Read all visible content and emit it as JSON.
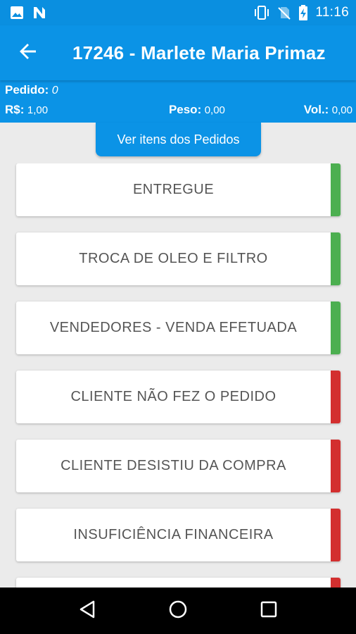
{
  "status_bar": {
    "time": "11:16",
    "left_icons": [
      "image-icon",
      "n-notification-icon"
    ],
    "right_icons": [
      "vibrate-icon",
      "no-sim-icon",
      "battery-charging-icon"
    ]
  },
  "app_bar": {
    "title": "17246 - Marlete Maria Primaz",
    "back_icon": "arrow-back-icon"
  },
  "info": {
    "pedido_label": "Pedido:",
    "pedido_value": "0",
    "rs_label": "R$:",
    "rs_value": "1,00",
    "peso_label": "Peso:",
    "peso_value": "0,00",
    "vol_label": "Vol.:",
    "vol_value": "0,00"
  },
  "ver_itens_button": "Ver itens dos Pedidos",
  "options": [
    {
      "label": "ENTREGUE",
      "status": "success"
    },
    {
      "label": "TROCA DE OLEO E FILTRO",
      "status": "success"
    },
    {
      "label": "VENDEDORES - VENDA EFETUADA",
      "status": "success"
    },
    {
      "label": "CLIENTE NÃO FEZ O PEDIDO",
      "status": "failure"
    },
    {
      "label": "CLIENTE DESISTIU DA COMPRA",
      "status": "failure"
    },
    {
      "label": "INSUFICIÊNCIA FINANCEIRA",
      "status": "failure"
    },
    {
      "label": "",
      "status": "failure"
    }
  ],
  "colors": {
    "primary": "#0b93e6",
    "success": "#4caf50",
    "failure": "#d32f2f",
    "background": "#ebebeb"
  },
  "nav_bar": {
    "icons": [
      "back-triangle-icon",
      "home-circle-icon",
      "recents-square-icon"
    ]
  }
}
